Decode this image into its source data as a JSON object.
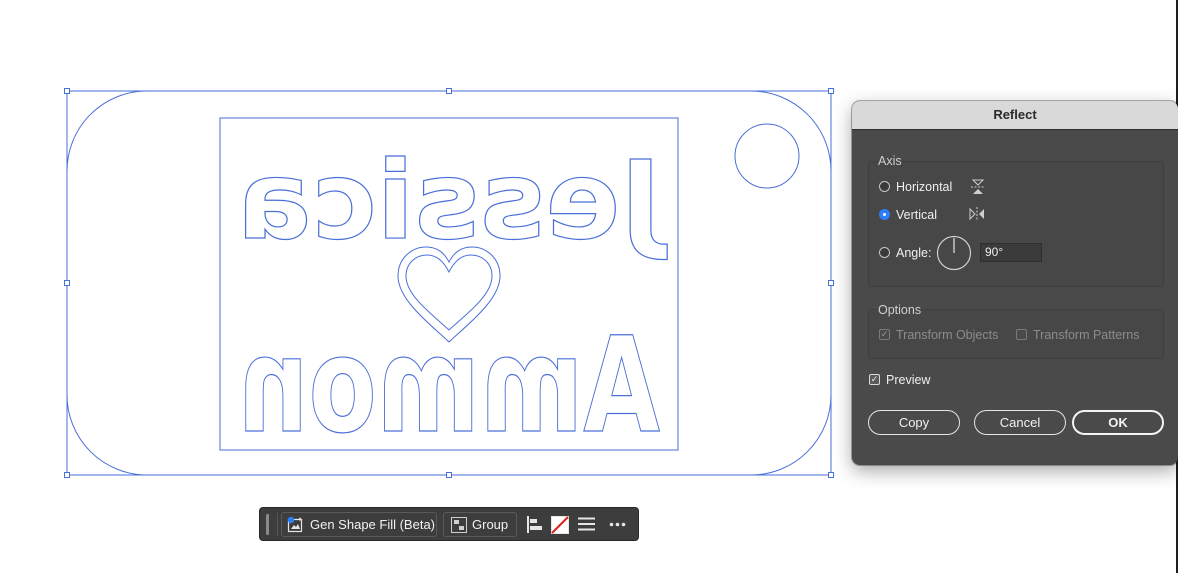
{
  "artwork": {
    "front_text": "Jessica",
    "back_text": "Ammon"
  },
  "dialog": {
    "title": "Reflect",
    "axis_group_label": "Axis",
    "horizontal_label": "Horizontal",
    "vertical_label": "Vertical",
    "angle_label": "Angle:",
    "angle_value": "90°",
    "selected_axis": "Vertical",
    "options_group_label": "Options",
    "transform_objects_label": "Transform Objects",
    "transform_objects_checked": true,
    "transform_patterns_label": "Transform Patterns",
    "transform_patterns_checked": false,
    "preview_label": "Preview",
    "preview_checked": true,
    "copy_label": "Copy",
    "cancel_label": "Cancel",
    "ok_label": "OK"
  },
  "taskbar": {
    "gen_shape_fill_label": "Gen Shape Fill (Beta)",
    "group_label": "Group",
    "icons": [
      "gen-shape-fill-icon",
      "group-icon",
      "align-icon",
      "fill-stroke-icon",
      "menu-icon",
      "more-icon"
    ]
  },
  "colors": {
    "selection_blue": "#4a6fd9",
    "dialog_bg": "#4a4a4a",
    "accent": "#2d7ff9"
  }
}
